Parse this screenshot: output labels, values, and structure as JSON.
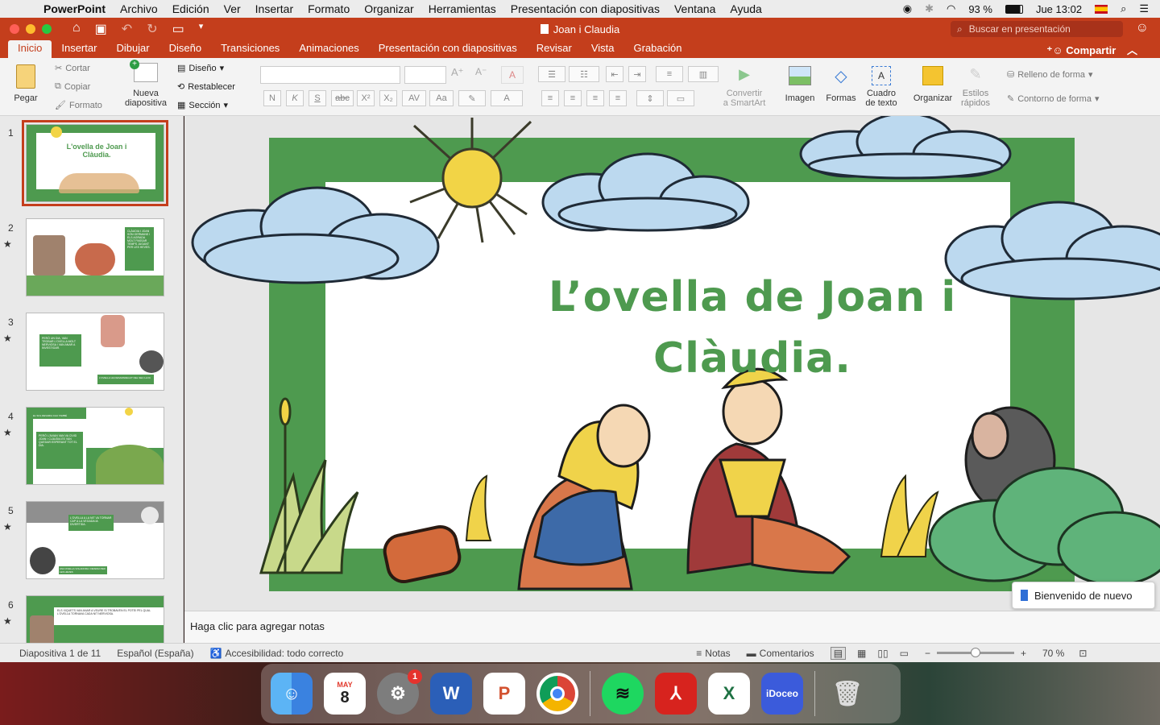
{
  "menubar": {
    "app": "PowerPoint",
    "items": [
      "Archivo",
      "Edición",
      "Ver",
      "Insertar",
      "Formato",
      "Organizar",
      "Herramientas",
      "Presentación con diapositivas",
      "Ventana",
      "Ayuda"
    ],
    "battery": "93 %",
    "clock": "Jue 13:02"
  },
  "titlebar": {
    "doc_title": "Joan i Claudia",
    "search_placeholder": "Buscar en presentación"
  },
  "tabs": [
    "Inicio",
    "Insertar",
    "Dibujar",
    "Diseño",
    "Transiciones",
    "Animaciones",
    "Presentación con diapositivas",
    "Revisar",
    "Vista",
    "Grabación"
  ],
  "share_label": "Compartir",
  "ribbon": {
    "paste": "Pegar",
    "cut": "Cortar",
    "copy": "Copiar",
    "format": "Formato",
    "new_slide_line1": "Nueva",
    "new_slide_line2": "diapositiva",
    "layout": "Diseño",
    "reset": "Restablecer",
    "section": "Sección",
    "convert_line1": "Convertir",
    "convert_line2": "a SmartArt",
    "image": "Imagen",
    "shapes": "Formas",
    "textbox_line1": "Cuadro",
    "textbox_line2": "de texto",
    "arrange": "Organizar",
    "quick_styles_line1": "Estilos",
    "quick_styles_line2": "rápidos",
    "shape_fill": "Relleno de forma",
    "shape_outline": "Contorno de forma",
    "fmt_buttons": [
      "N",
      "K",
      "S",
      "abc",
      "X²",
      "X₂"
    ]
  },
  "thumbnails": [
    {
      "num": "1",
      "star": "",
      "text": "L'ovella de Joan i Clàudia."
    },
    {
      "num": "2",
      "star": "★",
      "text": "CLÀUDIA I JOAN SÓN GERMANS I ELS AGRADA MOLT PASSAR TEMPS JUGANT PER LES HEVES."
    },
    {
      "num": "3",
      "star": "★",
      "text": "PERÒ UN DIA, VAN TROBAR L'OVELLA MOLT NERVIOSA I VAN ANAR A INVESTIGAR.",
      "text2": "L'OVELLA HA DESAPAREGUT DEL SEU LLOC"
    },
    {
      "num": "4",
      "star": "★",
      "text": "PERÒ L'AVIAN VAN VA CIVID JOAN I CLÀUDIA ES VAN QUEDAR ESPERANT TOT EL DIA.",
      "text2": "EL SOL DEVARIA CAU TAMBÉ"
    },
    {
      "num": "5",
      "star": "★",
      "text": "L'OVELLA A LA NIT VA TORNAR CAP A LA VEGADA IA DIVERTIDA.",
      "text2": "UNA OVELLA VOLADORA I DESMAI PER LES HEVES"
    },
    {
      "num": "6",
      "star": "★",
      "text": "ELS XIQUETS VAN ANAR A VEURE SI TROBAVEN EL POTEI PEL QUAL L'OVELLA TORNAVA CADA NIT NERVIOSA."
    }
  ],
  "slide": {
    "title_line1": "L’ovella de Joan i",
    "title_line2": "Clàudia."
  },
  "notes_placeholder": "Haga clic para agregar notas",
  "welcome_toast": "Bienvenido de nuevo",
  "status": {
    "slide_count": "Diapositiva 1 de 11",
    "language": "Español (España)",
    "accessibility": "Accesibilidad: todo correcto",
    "notes": "Notas",
    "comments": "Comentarios",
    "zoom": "70 %"
  },
  "dock": {
    "calendar_month": "MAY",
    "calendar_day": "8",
    "badge": "1",
    "idoceo": "iDoceo"
  },
  "colors": {
    "accent": "#c43e1c",
    "slide_green": "#4e9a4f"
  }
}
